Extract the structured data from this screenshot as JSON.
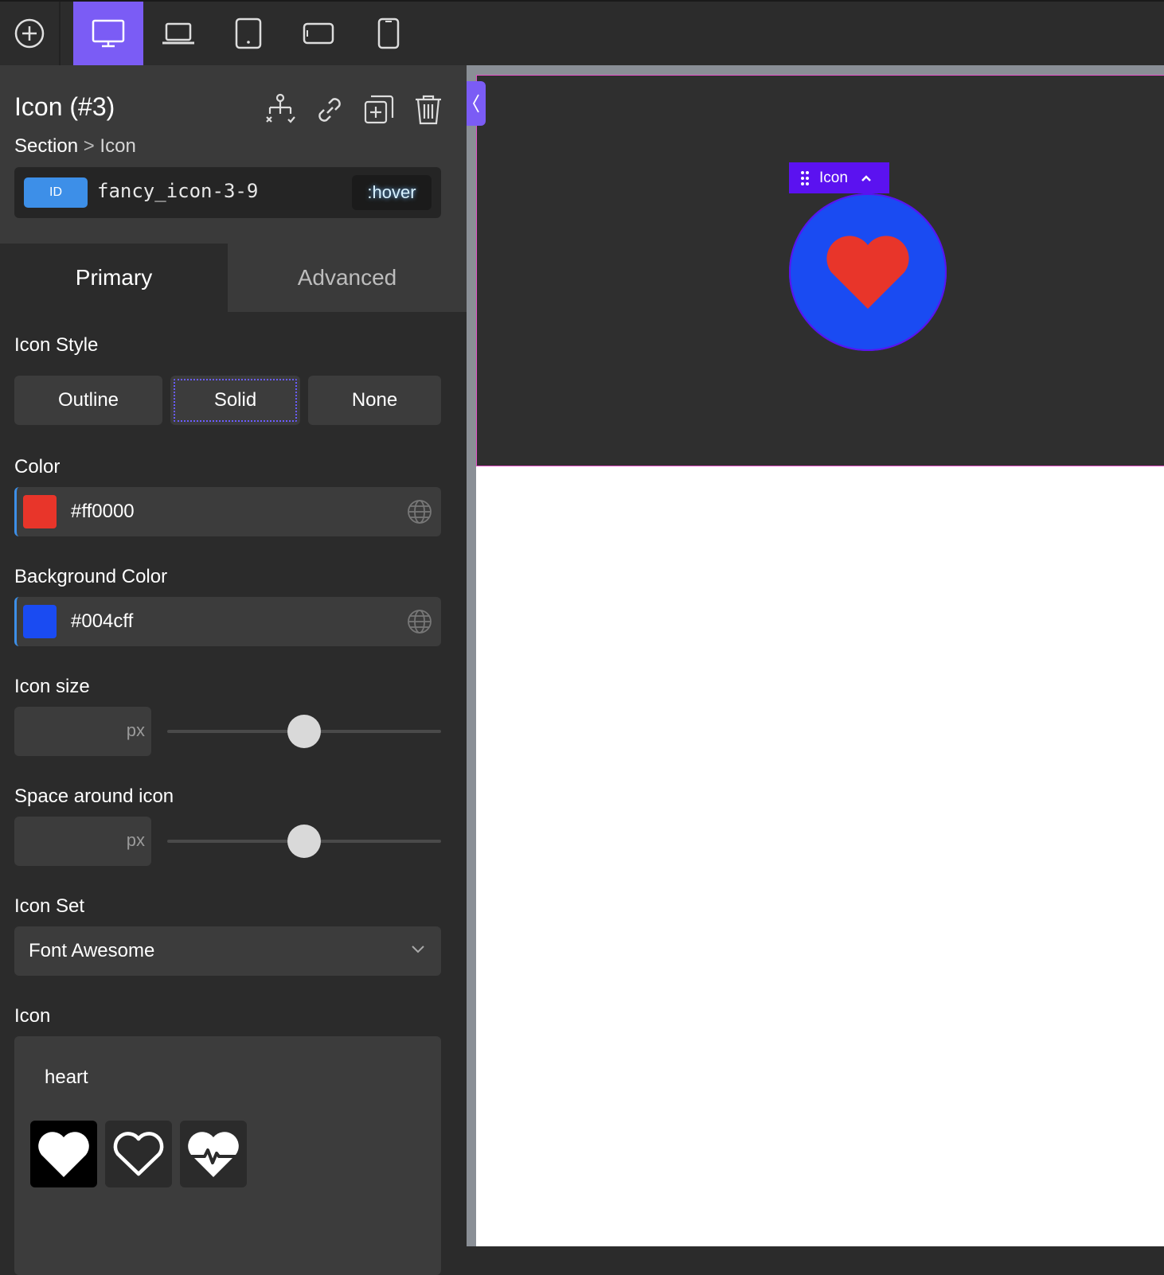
{
  "toolbar": {
    "add_icon": "plus-circle-icon",
    "devices": [
      {
        "name": "desktop",
        "icon": "monitor-icon",
        "active": true
      },
      {
        "name": "laptop",
        "icon": "laptop-icon",
        "active": false
      },
      {
        "name": "tablet",
        "icon": "tablet-icon",
        "active": false
      },
      {
        "name": "tablet-landscape",
        "icon": "tablet-landscape-icon",
        "active": false
      },
      {
        "name": "phone",
        "icon": "phone-icon",
        "active": false
      }
    ],
    "accent_color": "#7b5cf5"
  },
  "panel": {
    "title": "Icon (#3)",
    "breadcrumb": {
      "section": "Section",
      "separator": ">",
      "current": "Icon"
    },
    "id_badge": "ID",
    "id_value": "fancy_icon-3-9",
    "hover_button": ":hover",
    "tabs": [
      {
        "label": "Primary",
        "active": true
      },
      {
        "label": "Advanced",
        "active": false
      }
    ],
    "icon_style": {
      "label": "Icon Style",
      "options": [
        "Outline",
        "Solid",
        "None"
      ],
      "selected": "Solid"
    },
    "color": {
      "label": "Color",
      "value": "#ff0000",
      "swatch": "#e8352a"
    },
    "background_color": {
      "label": "Background Color",
      "value": "#004cff",
      "swatch": "#1a4bf2"
    },
    "icon_size": {
      "label": "Icon size",
      "value": "",
      "unit": "px",
      "slider_fraction": 0.5
    },
    "space_around": {
      "label": "Space around icon",
      "value": "",
      "unit": "px",
      "slider_fraction": 0.5
    },
    "icon_set": {
      "label": "Icon Set",
      "value": "Font Awesome"
    },
    "icon": {
      "label": "Icon",
      "search": "heart",
      "results": [
        {
          "icon": "heart-solid-icon",
          "selected": true
        },
        {
          "icon": "heart-outline-icon",
          "selected": false
        },
        {
          "icon": "heartbeat-icon",
          "selected": false
        }
      ]
    }
  },
  "canvas": {
    "element_label": "Icon",
    "icon_color": "#e8352a",
    "icon_background": "#1a4bf2",
    "label_color": "#5b12f0"
  }
}
